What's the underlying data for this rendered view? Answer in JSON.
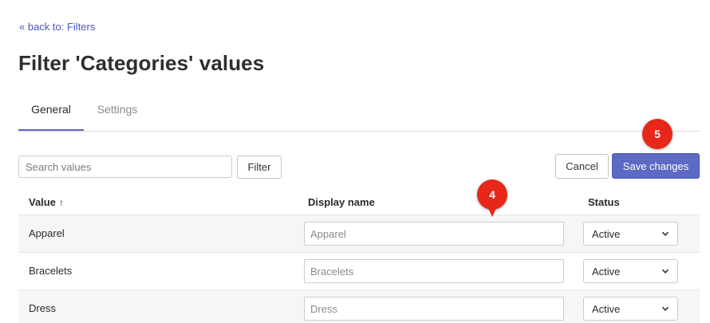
{
  "nav": {
    "back_link": "« back to: Filters"
  },
  "header": {
    "title": "Filter 'Categories' values"
  },
  "tabs": [
    {
      "label": "General",
      "active": true
    },
    {
      "label": "Settings",
      "active": false
    }
  ],
  "toolbar": {
    "search_placeholder": "Search values",
    "filter_label": "Filter",
    "cancel_label": "Cancel",
    "save_label": "Save changes"
  },
  "table": {
    "columns": {
      "value": "Value",
      "display": "Display name",
      "status": "Status"
    },
    "sort_indicator": "↑",
    "rows": [
      {
        "value": "Apparel",
        "display_placeholder": "Apparel",
        "status": "Active"
      },
      {
        "value": "Bracelets",
        "display_placeholder": "Bracelets",
        "status": "Active"
      },
      {
        "value": "Dress",
        "display_placeholder": "Dress",
        "status": "Active"
      }
    ]
  },
  "annotations": {
    "step_save": "5",
    "step_display": "4"
  },
  "colors": {
    "accent": "#5c6ac4",
    "link": "#4a55c2",
    "badge": "#e8271b"
  }
}
